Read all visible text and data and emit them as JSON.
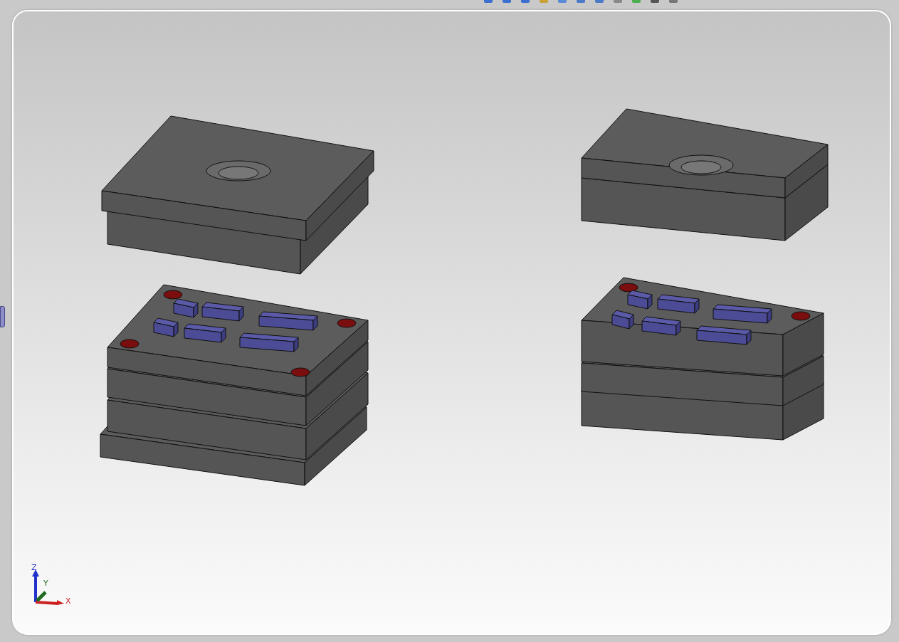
{
  "triad": {
    "z_label": "Z",
    "y_label": "Y",
    "x_label": "X"
  }
}
